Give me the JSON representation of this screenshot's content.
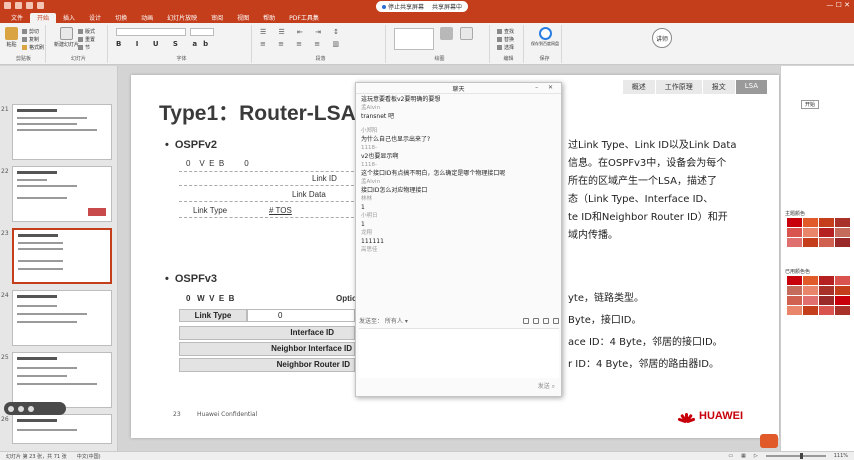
{
  "titlebar": {
    "meeting_label": "停止共享屏幕",
    "meeting_label2": "共享屏幕中",
    "controls": "— ☐ ✕"
  },
  "ribbon_tabs": [
    "文件",
    "开始",
    "插入",
    "设计",
    "切换",
    "动画",
    "幻灯片放映",
    "审阅",
    "视图",
    "帮助",
    "PDF工具集"
  ],
  "ribbon": {
    "paste": "粘贴",
    "cut": "剪切",
    "copy": "复制",
    "format_painter": "格式刷",
    "clipboard": "剪贴板",
    "new_slide": "新建幻灯片",
    "layout": "版式",
    "reset": "重置",
    "section": "节",
    "slides": "幻灯片",
    "font": "字体",
    "paragraph": "段落",
    "drawing": "绘图",
    "find": "查找",
    "replace": "替换",
    "select": "选择",
    "editing": "编辑",
    "save_share": "保存到百度网盘",
    "save_group": "保存",
    "avatar_text": "讲师"
  },
  "thumbnails": [
    {
      "num": "21"
    },
    {
      "num": "22"
    },
    {
      "num": "23",
      "selected": true
    },
    {
      "num": "24"
    },
    {
      "num": "25"
    },
    {
      "num": "26"
    }
  ],
  "slide": {
    "title": "Type1：Router-LSA",
    "nav_tabs": [
      "概述",
      "工作原理",
      "报文",
      "LSA"
    ],
    "nav_active": "LSA",
    "bullet_v2": "OSPFv2",
    "bullet_v3": "OSPFv3",
    "v2": {
      "flags": "0    V  E  B         0",
      "link_id": "Link ID",
      "link_data": "Link Data",
      "link_type": "Link Type",
      "tos": "# TOS"
    },
    "v3": {
      "flags": "0   W  V  E  B",
      "options": "Options",
      "link_type": "Link Type",
      "zero": "0",
      "interface_id": "Interface ID",
      "neighbor_interface_id": "Neighbor Interface ID",
      "neighbor_router_id": "Neighbor Router ID"
    },
    "body_lines": [
      "过Link Type、Link ID以及Link Data",
      "信息。在OSPFv3中，设备会为每个",
      "所在的区域产生一个LSA，描述了",
      "态（Link Type、Interface ID、",
      "te ID和Neighbor Router ID）和开",
      "域内传播。"
    ],
    "field_lines": [
      "yte，链路类型。",
      "Byte，接口ID。",
      "ace ID：4 Byte，邻居的接口ID。",
      "r ID：4 Byte，邻居的路由器ID。"
    ],
    "footer_num": "23",
    "footer_text": "Huawei Confidential",
    "brand": "HUAWEI"
  },
  "chat": {
    "title": "聊天",
    "messages": [
      {
        "name": "",
        "text": "這玩意要看板v2要明确的要想"
      },
      {
        "name": "孟Alvin",
        "text": "transnet 吧"
      },
      {
        "name": "小郑阳",
        "text": "为什么自己也显示出来了?"
      },
      {
        "name": "1118-",
        "text": "v2也要显示啊"
      },
      {
        "name": "1118-",
        "text": "这个接口ID有点搞不明白，怎么确定是哪个物理接口呢"
      },
      {
        "name": "孟Alvin",
        "text": "接口ID怎么对应物理接口"
      },
      {
        "name": "林林",
        "text": "1"
      },
      {
        "name": "小明日",
        "text": "1"
      },
      {
        "name": "龙翔",
        "text": "111111"
      },
      {
        "name": "高思佳",
        "text": ""
      }
    ],
    "input_placeholder": "发送至：  所有人 ▾",
    "send_label": "发送 ⌕"
  },
  "side_panel": {
    "open_label": "开始",
    "title1": "主题颜色",
    "title2": "已用颜色色"
  },
  "statusbar": {
    "slide_info": "幻灯片 第 23 张，共 71 张",
    "lang": "中文(中国)",
    "zoom": "111%"
  },
  "colors": {
    "brand": "#c43e1c",
    "huawei_red": "#c7000b"
  }
}
